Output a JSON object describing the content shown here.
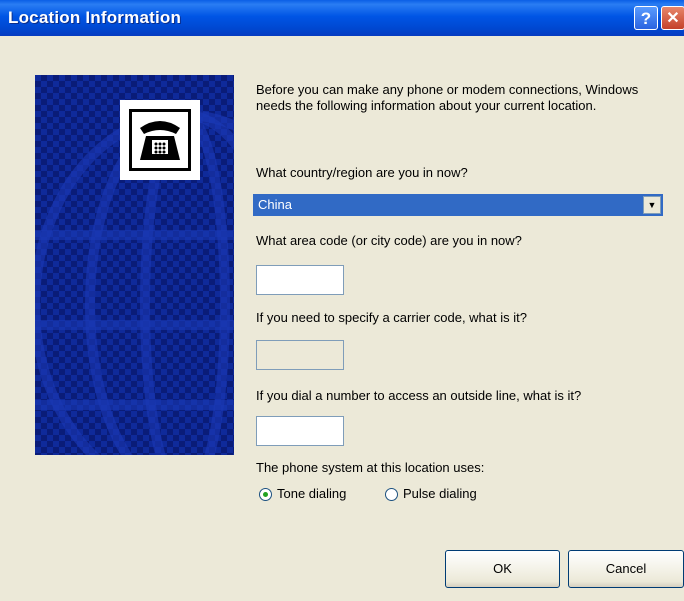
{
  "window": {
    "title": "Location Information"
  },
  "titlebar_buttons": {
    "help": "?",
    "close": "✕"
  },
  "intro_text": "Before you can make any phone or modem connections, Windows needs the following information about your current location.",
  "country": {
    "label": "What country/region are you in now?",
    "selected": "China"
  },
  "area_code": {
    "label": "What area code (or city code) are you in now?",
    "value": ""
  },
  "carrier_code": {
    "label": "If you need to specify a carrier code, what is it?",
    "value": ""
  },
  "outside_line": {
    "label": "If you dial a number to access an outside line, what is it?",
    "value": ""
  },
  "dialing": {
    "label": "The phone system at this location uses:",
    "options": [
      "Tone dialing",
      "Pulse dialing"
    ],
    "selected": "Tone dialing"
  },
  "buttons": {
    "ok": "OK",
    "cancel": "Cancel"
  },
  "colors": {
    "titlebar": "#0055e5",
    "dialog_bg": "#ece9d8",
    "selection": "#316ac5",
    "side_panel": "#0a1c78"
  },
  "icons": [
    "telephone-icon",
    "help-icon",
    "close-icon",
    "chevron-down-icon"
  ]
}
